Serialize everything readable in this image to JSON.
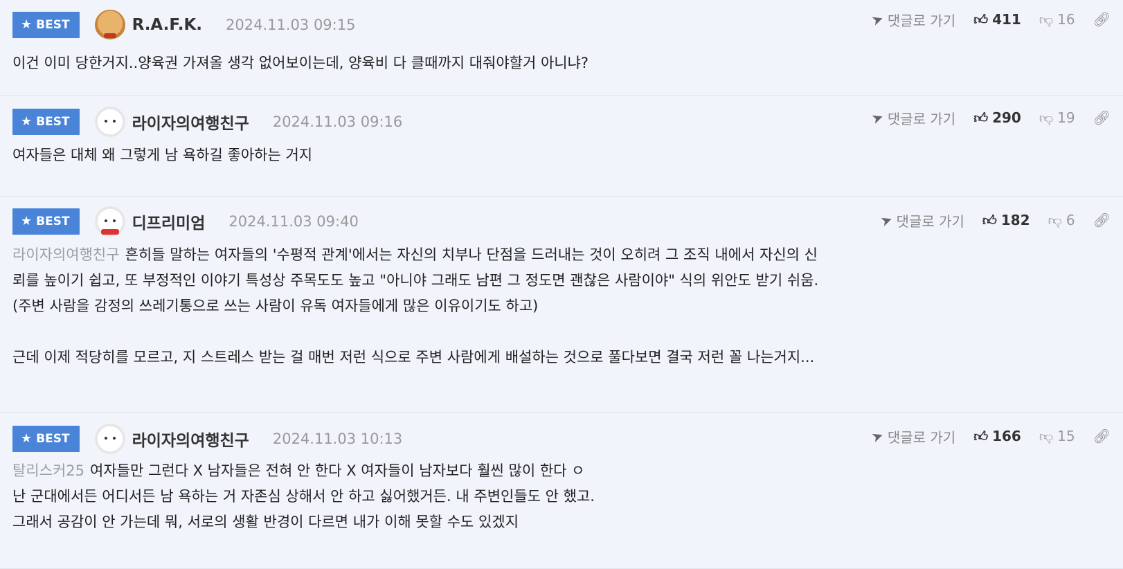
{
  "comments": [
    {
      "badge": "BEST",
      "nickname": "R.A.F.K.",
      "date": "2024.11.03 09:15",
      "reply_label": "댓글로 가기",
      "likes": "411",
      "dislikes": "16",
      "mention": "",
      "lines": [
        "이건 이미 당한거지..양육권 가져올 생각 없어보이는데, 양육비 다 클때까지 대줘야할거 아니냐?"
      ]
    },
    {
      "badge": "BEST",
      "nickname": "라이자의여행친구",
      "date": "2024.11.03 09:16",
      "reply_label": "댓글로 가기",
      "likes": "290",
      "dislikes": "19",
      "mention": "",
      "lines": [
        "여자들은 대체 왜 그렇게 남 욕하길 좋아하는 거지"
      ]
    },
    {
      "badge": "BEST",
      "nickname": "디프리미엄",
      "date": "2024.11.03 09:40",
      "reply_label": "댓글로 가기",
      "likes": "182",
      "dislikes": "6",
      "mention": "라이자의여행친구",
      "lines": [
        "흔히들 말하는 여자들의 '수평적 관계'에서는 자신의 치부나 단점을 드러내는 것이 오히려 그 조직 내에서 자신의 신",
        "뢰를 높이기 쉽고, 또 부정적인 이야기 특성상 주목도도 높고 \"아니야 그래도 남편 그 정도면 괜찮은 사람이야\" 식의 위안도 받기 쉬움.",
        "(주변 사람을 감정의 쓰레기통으로 쓰는 사람이 유독 여자들에게 많은 이유이기도 하고)",
        "",
        "근데 이제 적당히를 모르고, 지 스트레스 받는 걸 매번 저런 식으로 주변 사람에게 배설하는 것으로 풀다보면 결국 저런 꼴 나는거지..."
      ]
    },
    {
      "badge": "BEST",
      "nickname": "라이자의여행친구",
      "date": "2024.11.03 10:13",
      "reply_label": "댓글로 가기",
      "likes": "166",
      "dislikes": "15",
      "mention": "탈리스커25",
      "lines": [
        "여자들만 그런다 X 남자들은 전혀 안 한다 X 여자들이 남자보다 훨씬 많이 한다 ㅇ",
        "난 군대에서든 어디서든 남 욕하는 거 자존심 상해서 안 하고 싫어했거든. 내 주변인들도 안 했고.",
        "그래서 공감이 안 가는데 뭐, 서로의 생활 반경이 다르면 내가 이해 못할 수도 있겠지"
      ]
    }
  ],
  "icons": {
    "star": "star-icon",
    "reply": "send-arrow-icon",
    "like": "thumbs-up-icon",
    "dislike": "thumbs-down-icon",
    "link": "link-icon"
  },
  "colors": {
    "badge": "#4a84d8",
    "background": "#f1f4fb",
    "mention": "#9aa0a8"
  }
}
